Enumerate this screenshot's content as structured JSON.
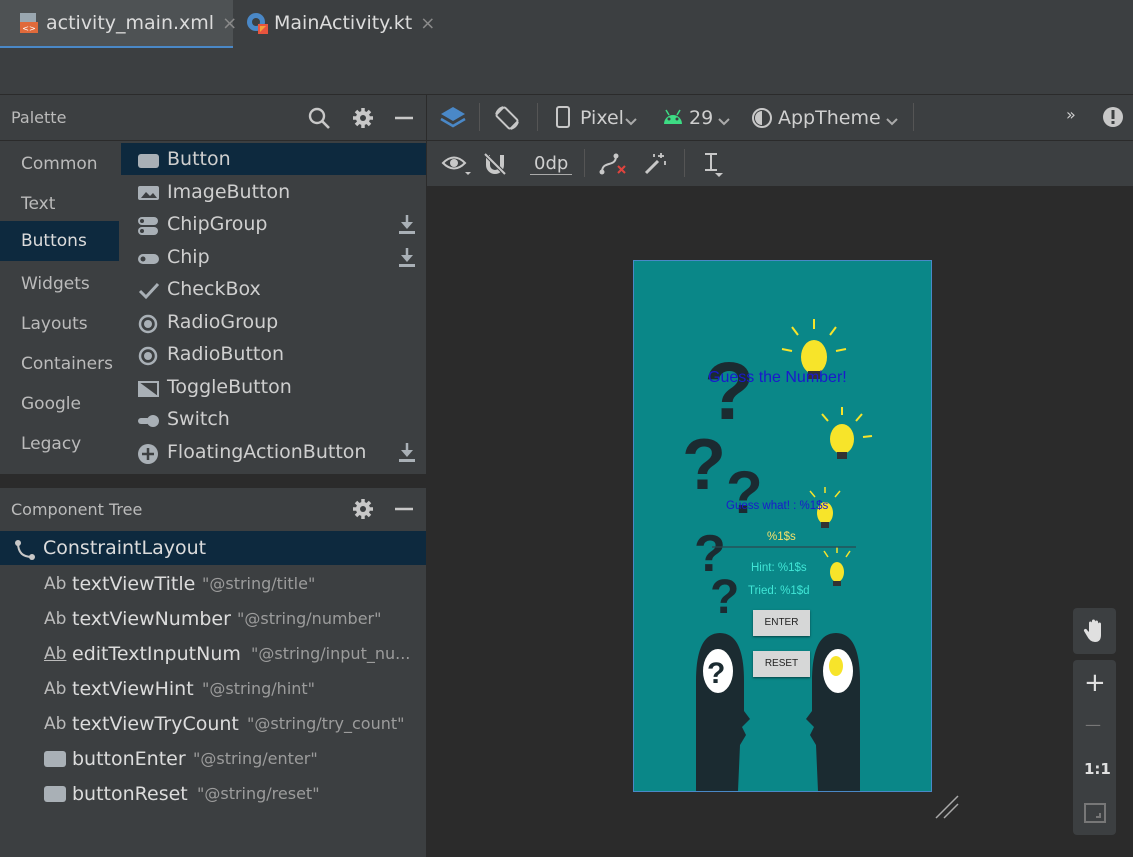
{
  "tabs": [
    {
      "label": "activity_main.xml",
      "close": "×"
    },
    {
      "label": "MainActivity.kt",
      "close": "×"
    }
  ],
  "palette": {
    "title": "Palette",
    "categories": [
      "Common",
      "Text",
      "Buttons",
      "Widgets",
      "Layouts",
      "Containers",
      "Google",
      "Legacy"
    ],
    "selected_category": "Buttons",
    "items": [
      "Button",
      "ImageButton",
      "ChipGroup",
      "Chip",
      "CheckBox",
      "RadioGroup",
      "RadioButton",
      "ToggleButton",
      "Switch",
      "FloatingActionButton"
    ],
    "selected_item": "Button"
  },
  "component_tree": {
    "title": "Component Tree",
    "root": "ConstraintLayout",
    "items": [
      {
        "badge": "Ab",
        "name": "textViewTitle",
        "value": "\"@string/title\""
      },
      {
        "badge": "Ab",
        "name": "textViewNumber",
        "value": "\"@string/number\""
      },
      {
        "badge": "Ab",
        "name": "editTextInputNum",
        "value": "\"@string/input_nu..."
      },
      {
        "badge": "Ab",
        "name": "textViewHint",
        "value": "\"@string/hint\""
      },
      {
        "badge": "Ab",
        "name": "textViewTryCount",
        "value": "\"@string/try_count\""
      },
      {
        "badge": "",
        "name": "buttonEnter",
        "value": "\"@string/enter\""
      },
      {
        "badge": "",
        "name": "buttonReset",
        "value": "\"@string/reset\""
      }
    ]
  },
  "design_toolbar": {
    "device": "Pixel",
    "api": "29",
    "theme": "AppTheme",
    "margin": "0dp",
    "overflow": "»"
  },
  "phone": {
    "title": "Guess the Number!",
    "number": "Guess what! : %1$s",
    "input": "%1$s",
    "hint": "Hint: %1$s",
    "tried": "Tried: %1$d",
    "enter": "ENTER",
    "reset": "RESET"
  },
  "zoom": {
    "plus": "+",
    "minus": "—",
    "one_to_one": "1:1"
  },
  "colors": {
    "accent": "#4a88c7",
    "selection": "#0d293e",
    "phone_bg": "#0a8788",
    "title_text": "#1a1acc"
  }
}
